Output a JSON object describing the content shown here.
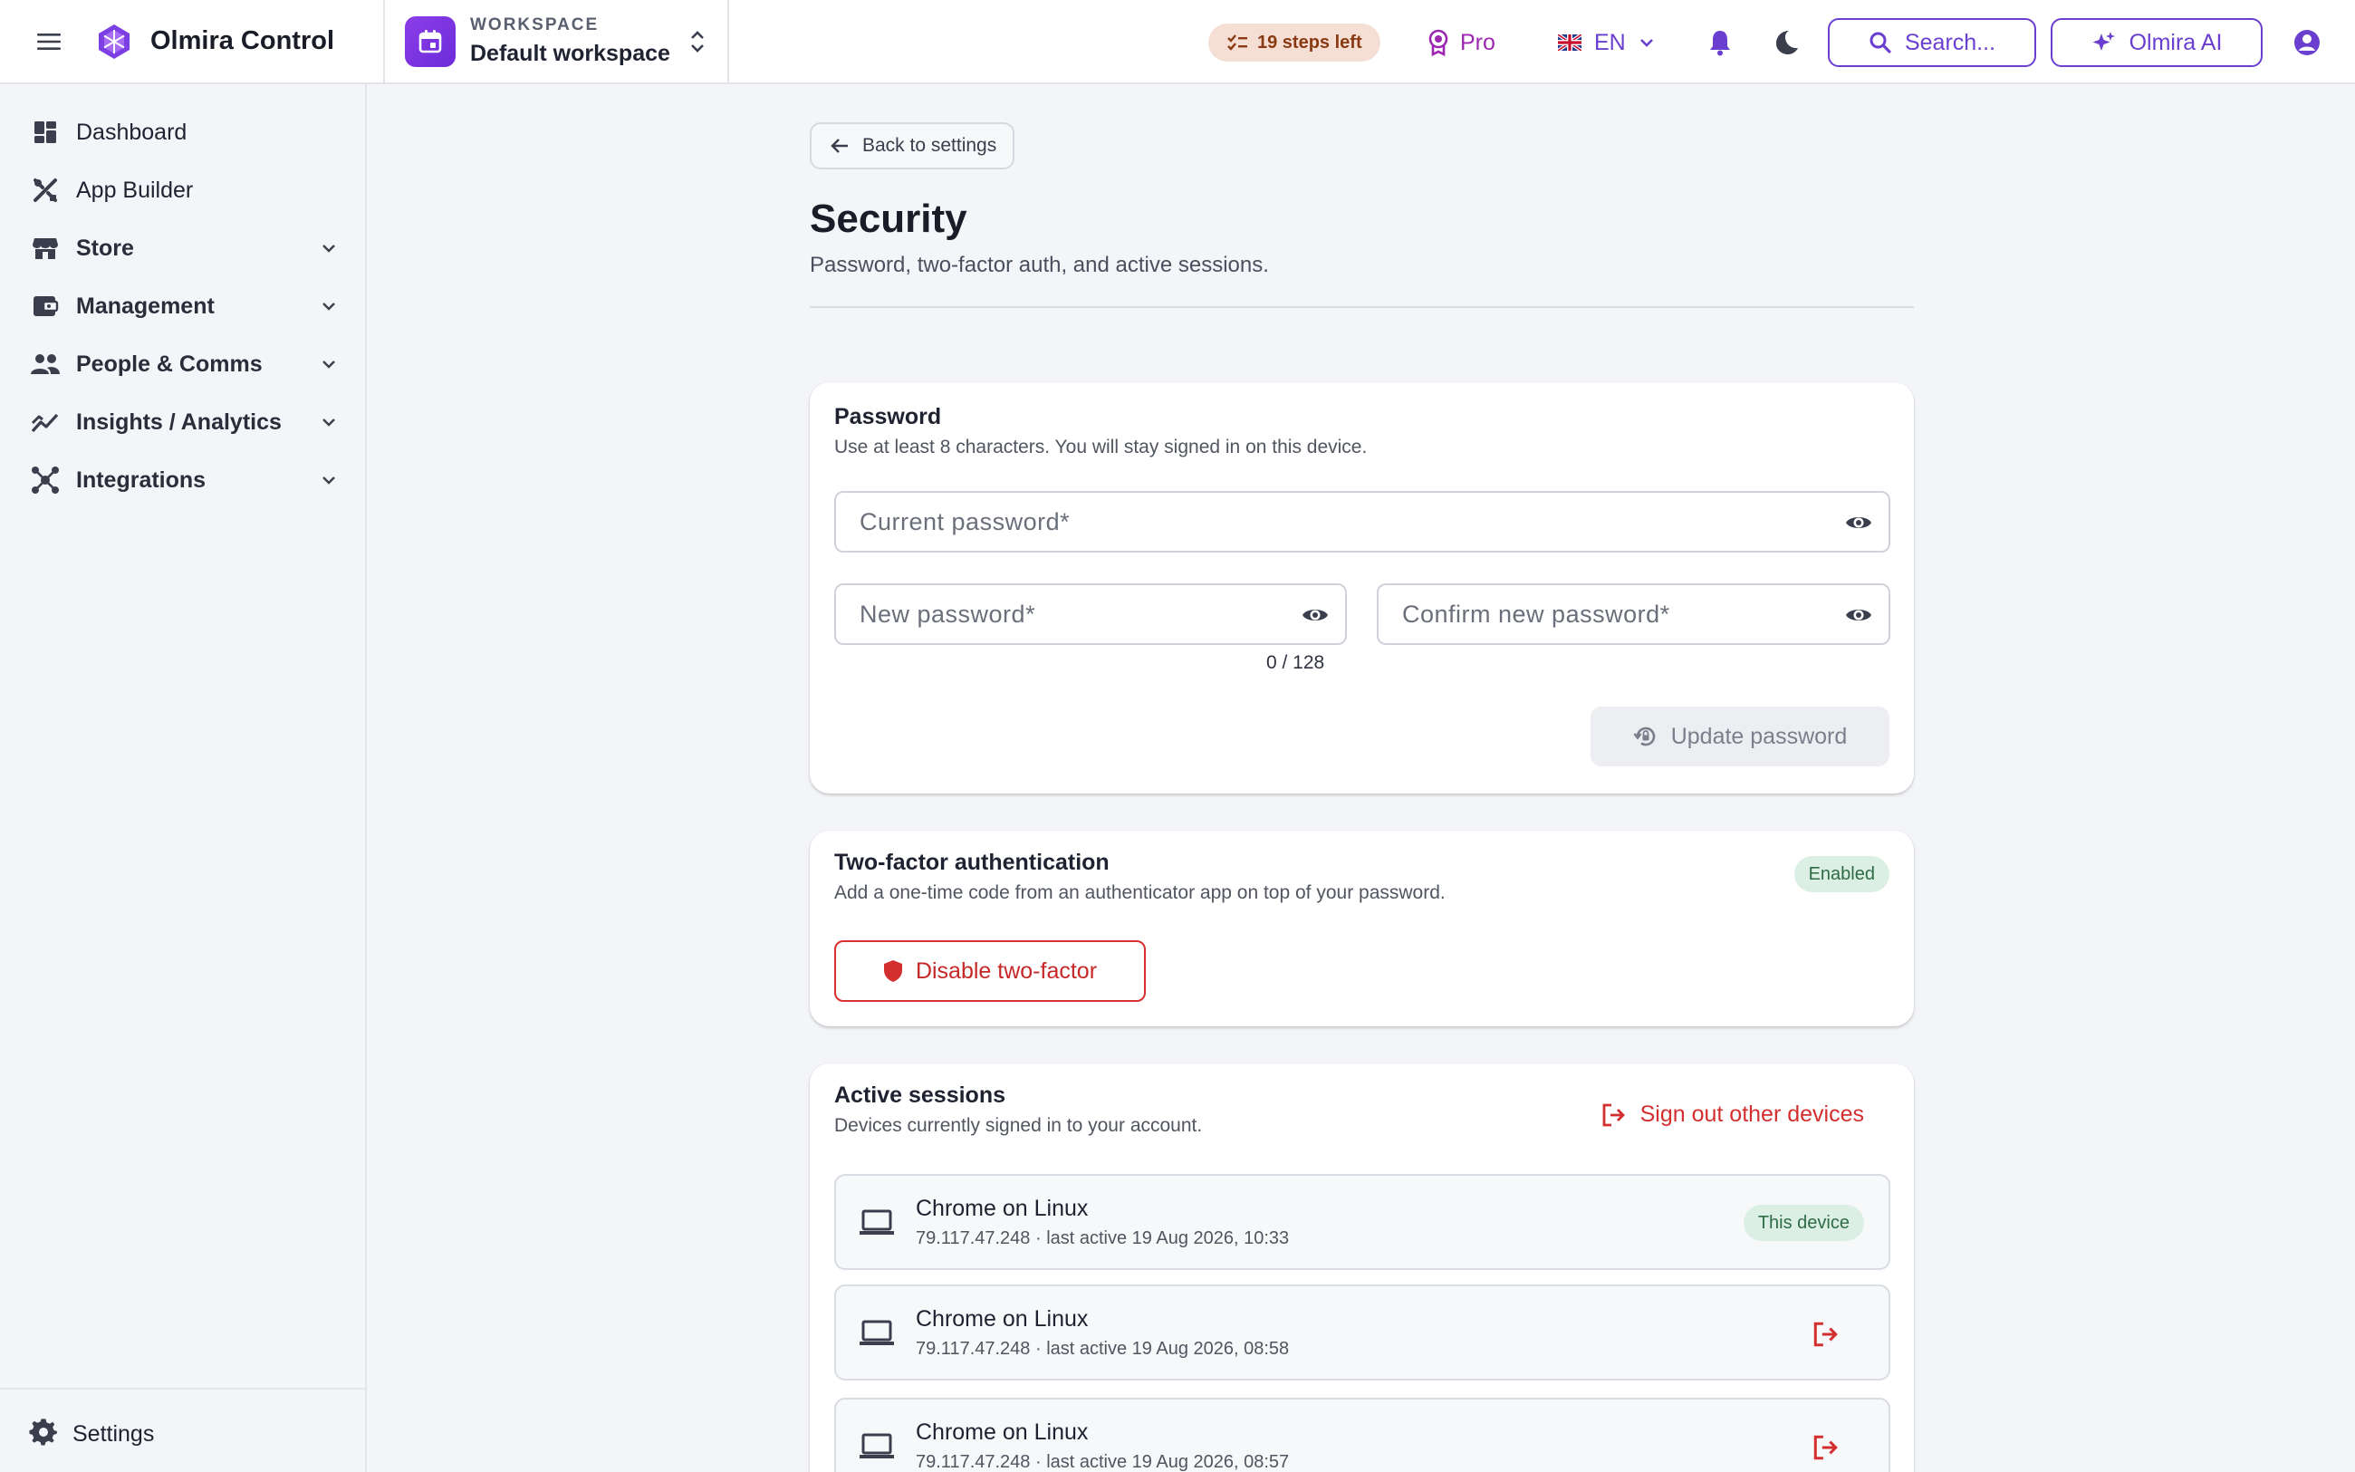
{
  "app": {
    "name": "Olmira Control"
  },
  "workspace": {
    "label": "WORKSPACE",
    "name": "Default workspace"
  },
  "header": {
    "steps_left": "19 steps left",
    "plan": "Pro",
    "language": "EN",
    "search_label": "Search...",
    "ai_label": "Olmira AI"
  },
  "sidebar": {
    "items": [
      {
        "label": "Dashboard",
        "icon": "dashboard-icon",
        "expandable": false
      },
      {
        "label": "App Builder",
        "icon": "tools-icon",
        "expandable": false
      },
      {
        "label": "Store",
        "icon": "store-icon",
        "expandable": true
      },
      {
        "label": "Management",
        "icon": "wallet-icon",
        "expandable": true
      },
      {
        "label": "People & Comms",
        "icon": "people-icon",
        "expandable": true
      },
      {
        "label": "Insights / Analytics",
        "icon": "trend-icon",
        "expandable": true
      },
      {
        "label": "Integrations",
        "icon": "hub-icon",
        "expandable": true
      }
    ],
    "settings_label": "Settings"
  },
  "page": {
    "back_label": "Back to settings",
    "title": "Security",
    "subtitle": "Password, two-factor auth, and active sessions."
  },
  "password": {
    "title": "Password",
    "description": "Use at least 8 characters. You will stay signed in on this device.",
    "current_placeholder": "Current password*",
    "new_placeholder": "New password*",
    "confirm_placeholder": "Confirm new password*",
    "counter": "0 / 128",
    "update_label": "Update password"
  },
  "two_factor": {
    "title": "Two-factor authentication",
    "description": "Add a one-time code from an authenticator app on top of your password.",
    "status": "Enabled",
    "disable_label": "Disable two-factor"
  },
  "sessions": {
    "title": "Active sessions",
    "description": "Devices currently signed in to your account.",
    "sign_out_all_label": "Sign out other devices",
    "this_device_label": "This device",
    "items": [
      {
        "name": "Chrome on Linux",
        "meta": "79.117.47.248 · last active 19 Aug 2026, 10:33",
        "current": true
      },
      {
        "name": "Chrome on Linux",
        "meta": "79.117.47.248 · last active 19 Aug 2026, 08:58",
        "current": false
      },
      {
        "name": "Chrome on Linux",
        "meta": "79.117.47.248 · last active 19 Aug 2026, 08:57",
        "current": false
      }
    ]
  },
  "colors": {
    "accent": "#6a3fd0",
    "danger": "#d32f2f",
    "success_bg": "#dcefe4",
    "success_text": "#2f6b45",
    "steps_bg": "#f5ded3"
  }
}
